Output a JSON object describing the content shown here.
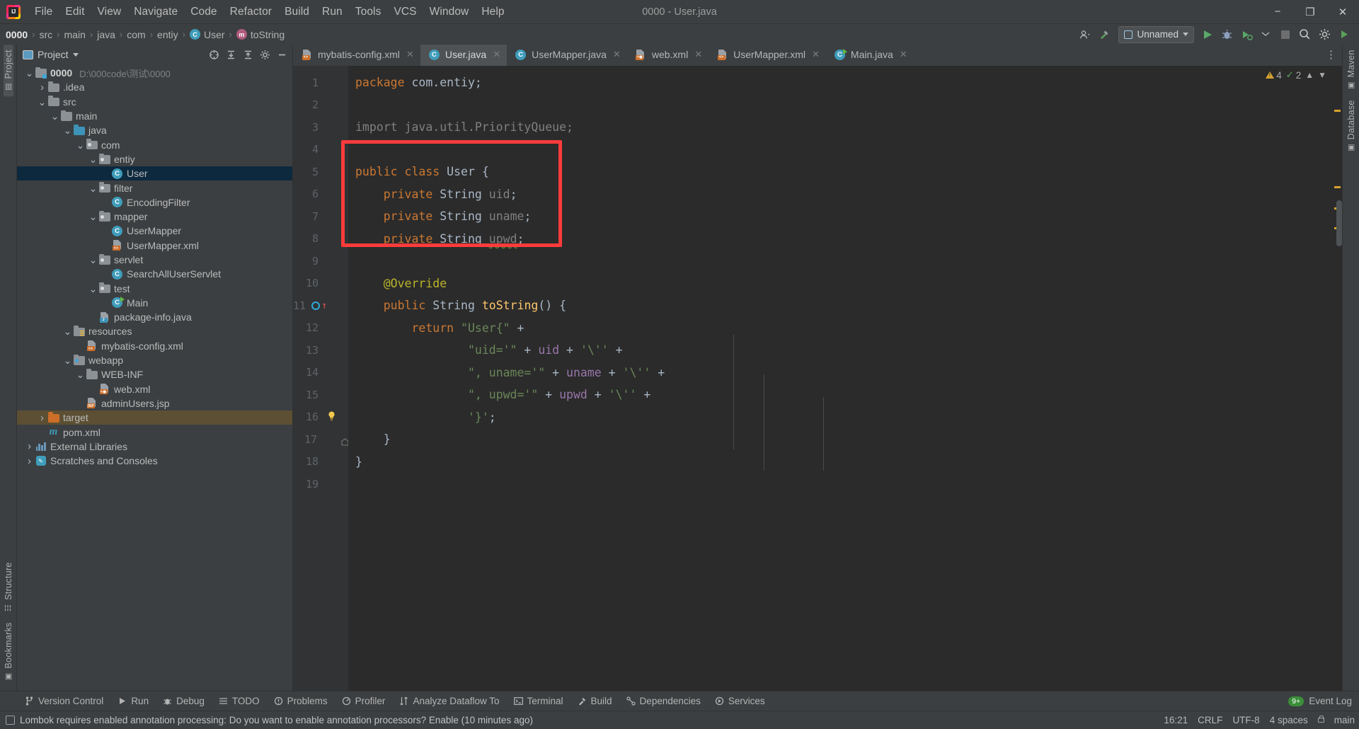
{
  "window": {
    "title": "0000 - User.java",
    "controls": {
      "minimize": "−",
      "maximize": "❐",
      "close": "✕"
    }
  },
  "menu": {
    "items": [
      {
        "label": "File"
      },
      {
        "label": "Edit"
      },
      {
        "label": "View"
      },
      {
        "label": "Navigate"
      },
      {
        "label": "Code"
      },
      {
        "label": "Refactor"
      },
      {
        "label": "Build"
      },
      {
        "label": "Run"
      },
      {
        "label": "Tools"
      },
      {
        "label": "VCS"
      },
      {
        "label": "Window"
      },
      {
        "label": "Help"
      }
    ]
  },
  "breadcrumb": {
    "items": [
      {
        "label": "0000",
        "icon": "",
        "bold": true
      },
      {
        "label": "src",
        "icon": ""
      },
      {
        "label": "main",
        "icon": ""
      },
      {
        "label": "java",
        "icon": ""
      },
      {
        "label": "com",
        "icon": ""
      },
      {
        "label": "entiy",
        "icon": ""
      },
      {
        "label": "User",
        "icon": "class-icon",
        "glyph": "C"
      },
      {
        "label": "toString",
        "icon": "method-icon",
        "glyph": "m"
      }
    ],
    "separator": "›"
  },
  "toolbar": {
    "run_config": "Unnamed",
    "icons": [
      {
        "name": "user-settings-icon",
        "glyph": "▾"
      },
      {
        "name": "hammer-build-icon",
        "glyph": "⚒"
      },
      {
        "name": "run-icon",
        "glyph": "▶"
      },
      {
        "name": "debug-icon",
        "glyph": "ὁE"
      },
      {
        "name": "run-coverage-icon",
        "glyph": "▶"
      },
      {
        "name": "more-run-icon",
        "glyph": "▾"
      },
      {
        "name": "stop-icon",
        "glyph": "■"
      },
      {
        "name": "search-everywhere-icon",
        "glyph": "ὐD"
      },
      {
        "name": "settings-gear-icon",
        "glyph": "⚙"
      },
      {
        "name": "updates-icon",
        "glyph": "▶"
      }
    ]
  },
  "left_stripe": {
    "top": [
      {
        "label": "Project",
        "active": true
      }
    ],
    "bottom": [
      {
        "label": "Structure"
      },
      {
        "label": "Bookmarks"
      }
    ]
  },
  "right_stripe": {
    "items": [
      {
        "label": "Maven"
      },
      {
        "label": "Database"
      }
    ]
  },
  "project_panel": {
    "title": "Project",
    "tools": [
      {
        "name": "select-opened-file-icon",
        "glyph": "⊕"
      },
      {
        "name": "expand-all-icon",
        "glyph": "⤓"
      },
      {
        "name": "collapse-all-icon",
        "glyph": "⤒"
      },
      {
        "name": "settings-icon",
        "glyph": "⚙"
      },
      {
        "name": "hide-icon",
        "glyph": "—"
      }
    ],
    "tree": [
      {
        "depth": 0,
        "twist": "v",
        "icon": "module-folder-icon",
        "label": "0000",
        "bold": true,
        "path": "D:\\000code\\测试\\0000"
      },
      {
        "depth": 1,
        "twist": ">",
        "icon": "folder-icon",
        "label": ".idea"
      },
      {
        "depth": 1,
        "twist": "v",
        "icon": "folder-icon",
        "label": "src"
      },
      {
        "depth": 2,
        "twist": "v",
        "icon": "folder-icon",
        "label": "main"
      },
      {
        "depth": 3,
        "twist": "v",
        "icon": "source-folder-icon",
        "label": "java"
      },
      {
        "depth": 4,
        "twist": "v",
        "icon": "package-icon",
        "label": "com"
      },
      {
        "depth": 5,
        "twist": "v",
        "icon": "package-icon",
        "label": "entiy"
      },
      {
        "depth": 6,
        "twist": "",
        "icon": "class-icon",
        "label": "User",
        "selected": true
      },
      {
        "depth": 5,
        "twist": "v",
        "icon": "package-icon",
        "label": "filter"
      },
      {
        "depth": 6,
        "twist": "",
        "icon": "class-icon",
        "label": "EncodingFilter"
      },
      {
        "depth": 5,
        "twist": "v",
        "icon": "package-icon",
        "label": "mapper"
      },
      {
        "depth": 6,
        "twist": "",
        "icon": "class-icon",
        "label": "UserMapper"
      },
      {
        "depth": 6,
        "twist": "",
        "icon": "xml-file-icon",
        "label": "UserMapper.xml"
      },
      {
        "depth": 5,
        "twist": "v",
        "icon": "package-icon",
        "label": "servlet"
      },
      {
        "depth": 6,
        "twist": "",
        "icon": "class-icon",
        "label": "SearchAllUserServlet"
      },
      {
        "depth": 5,
        "twist": "v",
        "icon": "package-icon",
        "label": "test"
      },
      {
        "depth": 6,
        "twist": "",
        "icon": "runnable-class-icon",
        "label": "Main"
      },
      {
        "depth": 5,
        "twist": "",
        "icon": "java-file-icon",
        "label": "package-info.java"
      },
      {
        "depth": 3,
        "twist": "v",
        "icon": "resources-folder-icon",
        "label": "resources"
      },
      {
        "depth": 4,
        "twist": "",
        "icon": "xml-file-icon",
        "label": "mybatis-config.xml"
      },
      {
        "depth": 3,
        "twist": "v",
        "icon": "webapp-folder-icon",
        "label": "webapp"
      },
      {
        "depth": 4,
        "twist": "v",
        "icon": "folder-icon",
        "label": "WEB-INF"
      },
      {
        "depth": 5,
        "twist": "",
        "icon": "webxml-file-icon",
        "label": "web.xml"
      },
      {
        "depth": 4,
        "twist": "",
        "icon": "jsp-file-icon",
        "label": "adminUsers.jsp"
      },
      {
        "depth": 1,
        "twist": ">",
        "icon": "target-folder-icon",
        "label": "target",
        "highlight": true
      },
      {
        "depth": 1,
        "twist": "",
        "icon": "maven-file-icon",
        "label": "pom.xml"
      },
      {
        "depth": 0,
        "twist": ">",
        "icon": "libraries-icon",
        "label": "External Libraries"
      },
      {
        "depth": 0,
        "twist": ">",
        "icon": "scratches-icon",
        "label": "Scratches and Consoles"
      }
    ]
  },
  "editor": {
    "tabs": [
      {
        "label": "mybatis-config.xml",
        "icon": "xml-file-icon",
        "active": false
      },
      {
        "label": "User.java",
        "icon": "class-icon",
        "active": true
      },
      {
        "label": "UserMapper.java",
        "icon": "class-icon",
        "active": false
      },
      {
        "label": "web.xml",
        "icon": "webxml-file-icon",
        "active": false
      },
      {
        "label": "UserMapper.xml",
        "icon": "xml-file-icon",
        "active": false
      },
      {
        "label": "Main.java",
        "icon": "runnable-class-icon",
        "active": false
      }
    ],
    "tab_close_glyph": "✕",
    "more_tabs_glyph": "⋮",
    "inspections": {
      "warnings": "4",
      "checks": "2",
      "collapse_glyph": "⌃",
      "expand_glyph": "⌄"
    },
    "line_numbers": [
      "1",
      "2",
      "3",
      "4",
      "5",
      "6",
      "7",
      "8",
      "9",
      "10",
      "11",
      "12",
      "13",
      "14",
      "15",
      "16",
      "17",
      "18",
      "19"
    ],
    "code_lines": [
      {
        "n": 1,
        "tokens": [
          {
            "t": "package",
            "c": "kw"
          },
          {
            "t": " ",
            "c": "pl"
          },
          {
            "t": "com.entiy",
            "c": "typ"
          },
          {
            "t": ";",
            "c": "pl"
          }
        ]
      },
      {
        "n": 2,
        "tokens": []
      },
      {
        "n": 3,
        "tokens": [
          {
            "t": "import java.util.PriorityQueue;",
            "c": "grey"
          }
        ]
      },
      {
        "n": 4,
        "tokens": []
      },
      {
        "n": 5,
        "tokens": [
          {
            "t": "public class ",
            "c": "kw"
          },
          {
            "t": "User",
            "c": "typ"
          },
          {
            "t": " {",
            "c": "pl"
          }
        ]
      },
      {
        "n": 6,
        "tokens": [
          {
            "t": "    ",
            "c": "pl"
          },
          {
            "t": "private",
            "c": "kw"
          },
          {
            "t": " ",
            "c": "pl"
          },
          {
            "t": "String",
            "c": "typ"
          },
          {
            "t": " ",
            "c": "pl"
          },
          {
            "t": "uid",
            "c": "grey"
          },
          {
            "t": ";",
            "c": "pl"
          }
        ]
      },
      {
        "n": 7,
        "tokens": [
          {
            "t": "    ",
            "c": "pl"
          },
          {
            "t": "private",
            "c": "kw"
          },
          {
            "t": " ",
            "c": "pl"
          },
          {
            "t": "String",
            "c": "typ"
          },
          {
            "t": " ",
            "c": "pl"
          },
          {
            "t": "uname",
            "c": "grey"
          },
          {
            "t": ";",
            "c": "pl"
          }
        ]
      },
      {
        "n": 8,
        "tokens": [
          {
            "t": "    ",
            "c": "pl"
          },
          {
            "t": "private",
            "c": "kw"
          },
          {
            "t": " ",
            "c": "pl"
          },
          {
            "t": "String",
            "c": "typ"
          },
          {
            "t": " ",
            "c": "pl"
          },
          {
            "t": "upwd",
            "c": "grey wavy"
          },
          {
            "t": ";",
            "c": "pl"
          }
        ]
      },
      {
        "n": 9,
        "tokens": []
      },
      {
        "n": 10,
        "tokens": [
          {
            "t": "    ",
            "c": "pl"
          },
          {
            "t": "@Override",
            "c": "ann"
          }
        ]
      },
      {
        "n": 11,
        "tokens": [
          {
            "t": "    ",
            "c": "pl"
          },
          {
            "t": "public",
            "c": "kw"
          },
          {
            "t": " ",
            "c": "pl"
          },
          {
            "t": "String",
            "c": "typ"
          },
          {
            "t": " ",
            "c": "pl"
          },
          {
            "t": "toString",
            "c": "mth"
          },
          {
            "t": "() {",
            "c": "pl"
          }
        ]
      },
      {
        "n": 12,
        "tokens": [
          {
            "t": "        ",
            "c": "pl"
          },
          {
            "t": "return",
            "c": "kw"
          },
          {
            "t": " ",
            "c": "pl"
          },
          {
            "t": "\"User{\"",
            "c": "str"
          },
          {
            "t": " +",
            "c": "pl"
          }
        ]
      },
      {
        "n": 13,
        "tokens": [
          {
            "t": "                ",
            "c": "pl"
          },
          {
            "t": "\"uid='\"",
            "c": "str"
          },
          {
            "t": " + ",
            "c": "pl"
          },
          {
            "t": "uid",
            "c": "fld2"
          },
          {
            "t": " + ",
            "c": "pl"
          },
          {
            "t": "'\\''",
            "c": "str"
          },
          {
            "t": " +",
            "c": "pl"
          }
        ]
      },
      {
        "n": 14,
        "tokens": [
          {
            "t": "                ",
            "c": "pl"
          },
          {
            "t": "\", uname='\"",
            "c": "str"
          },
          {
            "t": " + ",
            "c": "pl"
          },
          {
            "t": "uname",
            "c": "fld2"
          },
          {
            "t": " + ",
            "c": "pl"
          },
          {
            "t": "'\\''",
            "c": "str"
          },
          {
            "t": " +",
            "c": "pl"
          }
        ]
      },
      {
        "n": 15,
        "tokens": [
          {
            "t": "                ",
            "c": "pl"
          },
          {
            "t": "\", upwd='\"",
            "c": "str"
          },
          {
            "t": " + ",
            "c": "pl"
          },
          {
            "t": "upwd",
            "c": "fld2"
          },
          {
            "t": " + ",
            "c": "pl"
          },
          {
            "t": "'\\''",
            "c": "str"
          },
          {
            "t": " +",
            "c": "pl"
          }
        ]
      },
      {
        "n": 16,
        "tokens": [
          {
            "t": "                ",
            "c": "pl"
          },
          {
            "t": "'}'",
            "c": "str"
          },
          {
            "t": ";",
            "c": "pl"
          }
        ]
      },
      {
        "n": 17,
        "tokens": [
          {
            "t": "    }",
            "c": "pl"
          }
        ]
      },
      {
        "n": 18,
        "tokens": [
          {
            "t": "}",
            "c": "pl"
          }
        ]
      },
      {
        "n": 19,
        "tokens": []
      }
    ],
    "gutter_markers": [
      {
        "line": 11,
        "icons": [
          "override-method-icon",
          "implements-arrow-icon",
          "fold-collapse-icon"
        ]
      },
      {
        "line": 16,
        "icons": [
          "intention-bulb-icon"
        ]
      },
      {
        "line": 17,
        "icons": [
          "fold-end-icon"
        ]
      }
    ],
    "annotation_box": {
      "color": "#ff3b3b",
      "covers_lines": "5-8"
    }
  },
  "bottom_bar": {
    "items": [
      {
        "label": "Version Control",
        "icon": "branch-icon"
      },
      {
        "label": "Run",
        "icon": "run-icon"
      },
      {
        "label": "Debug",
        "icon": "debug-icon"
      },
      {
        "label": "TODO",
        "icon": "todo-icon"
      },
      {
        "label": "Problems",
        "icon": "problems-icon"
      },
      {
        "label": "Profiler",
        "icon": "profiler-icon"
      },
      {
        "label": "Analyze Dataflow To",
        "icon": "dataflow-icon"
      },
      {
        "label": "Terminal",
        "icon": "terminal-icon"
      },
      {
        "label": "Build",
        "icon": "build-icon"
      },
      {
        "label": "Dependencies",
        "icon": "dependencies-icon"
      },
      {
        "label": "Services",
        "icon": "services-icon"
      }
    ],
    "event_log": {
      "label": "Event Log",
      "badge": "9+"
    }
  },
  "status_bar": {
    "message": "Lombok requires enabled annotation processing: Do you want to enable annotation processors? Enable (10 minutes ago)",
    "time": "16:21",
    "line_sep": "CRLF",
    "encoding": "UTF-8",
    "indent": "4 spaces",
    "branch": "main"
  },
  "colors": {
    "accent_blue": "#3f9dbb",
    "annotation_red": "#ff3b3b",
    "selection_blue": "#0d293e",
    "highlight_brown": "#5c4f33",
    "editor_bg": "#2b2b2b",
    "panel_bg": "#3c3f41"
  }
}
